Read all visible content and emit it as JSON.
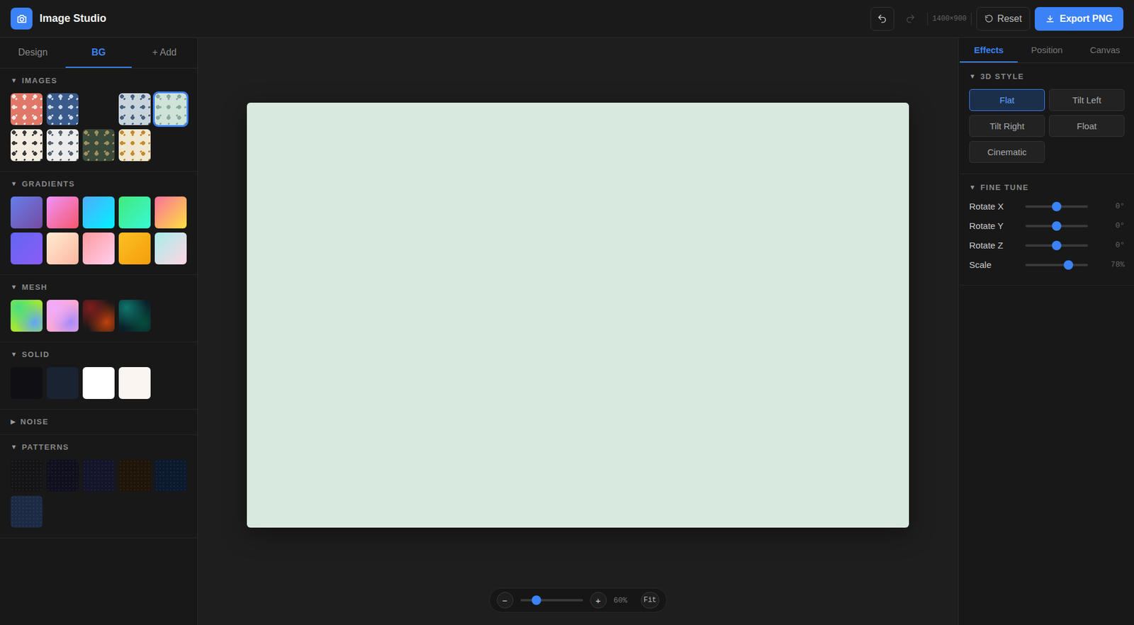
{
  "app": {
    "title": "Image Studio"
  },
  "toolbar": {
    "undo": {
      "disabled": false
    },
    "redo": {
      "disabled": true
    },
    "size": "1400×900",
    "reset": "Reset",
    "export": "Export PNG"
  },
  "left_tabs": [
    {
      "label": "Design",
      "selected": false
    },
    {
      "label": "BG",
      "selected": true
    },
    {
      "label": "+ Add",
      "selected": false
    }
  ],
  "sections": [
    {
      "title": "IMAGES",
      "arrow": "▼",
      "expanded": true,
      "kind": "image",
      "swatches": [
        {
          "colors": [
            "#e0786a",
            "#f2e6e0"
          ],
          "loaded": true,
          "selected": false
        },
        {
          "colors": [
            "#3a5a8c",
            "#c8d8e8"
          ],
          "loaded": true,
          "selected": false
        },
        {
          "colors": [
            "#181818",
            "#181818"
          ],
          "loaded": false,
          "selected": false
        },
        {
          "colors": [
            "#c8d4dc",
            "#4a6080"
          ],
          "loaded": true,
          "selected": false
        },
        {
          "colors": [
            "#cfe3d8",
            "#8aa8a0"
          ],
          "loaded": true,
          "selected": true
        },
        {
          "colors": [
            "#f4ece0",
            "#3a3a3a"
          ],
          "loaded": true,
          "selected": false
        },
        {
          "colors": [
            "#ececec",
            "#5a6470"
          ],
          "loaded": true,
          "selected": false
        },
        {
          "colors": [
            "#3a4a3a",
            "#a09060"
          ],
          "loaded": true,
          "selected": false
        },
        {
          "colors": [
            "#f0e8d0",
            "#c88a30"
          ],
          "loaded": true,
          "selected": false
        }
      ]
    },
    {
      "title": "GRADIENTS",
      "arrow": "▼",
      "expanded": true,
      "kind": "gradient",
      "swatches": [
        {
          "colors": [
            "#667eea",
            "#764ba2"
          ],
          "loaded": true,
          "selected": false
        },
        {
          "colors": [
            "#f093fb",
            "#f5576c"
          ],
          "loaded": true,
          "selected": false
        },
        {
          "colors": [
            "#4facfe",
            "#00f2fe"
          ],
          "loaded": true,
          "selected": false
        },
        {
          "colors": [
            "#43e97b",
            "#38f9d7"
          ],
          "loaded": true,
          "selected": false
        },
        {
          "colors": [
            "#fa709a",
            "#fee140"
          ],
          "loaded": true,
          "selected": false
        },
        {
          "colors": [
            "#6366f1",
            "#8b5cf6"
          ],
          "loaded": true,
          "selected": false
        },
        {
          "colors": [
            "#ffecd2",
            "#fcb69f"
          ],
          "loaded": true,
          "selected": false
        },
        {
          "colors": [
            "#ff9a9e",
            "#fecfef"
          ],
          "loaded": true,
          "selected": false
        },
        {
          "colors": [
            "#fbbf24",
            "#f59e0b"
          ],
          "loaded": true,
          "selected": false
        },
        {
          "colors": [
            "#a8edea",
            "#fed6e3"
          ],
          "loaded": true,
          "selected": false
        }
      ]
    },
    {
      "title": "MESH",
      "arrow": "▼",
      "expanded": true,
      "kind": "mesh",
      "swatches": [
        {
          "colors": [
            "#4ade80",
            "#60a5fa",
            "#a3e635"
          ],
          "loaded": true,
          "selected": false
        },
        {
          "colors": [
            "#f0abfc",
            "#a78bfa",
            "#f9a8d4"
          ],
          "loaded": true,
          "selected": false
        },
        {
          "colors": [
            "#7f1d1d",
            "#c2410c",
            "#1c1917"
          ],
          "loaded": true,
          "selected": false
        },
        {
          "colors": [
            "#0f766e",
            "#064e3b",
            "#0b1f2a"
          ],
          "loaded": true,
          "selected": false
        }
      ]
    },
    {
      "title": "SOLID",
      "arrow": "▼",
      "expanded": true,
      "kind": "solid",
      "swatches": [
        {
          "colors": [
            "#0f0f14"
          ],
          "loaded": true,
          "selected": false
        },
        {
          "colors": [
            "#1a2332"
          ],
          "loaded": true,
          "selected": false
        },
        {
          "colors": [
            "#ffffff"
          ],
          "loaded": true,
          "selected": false
        },
        {
          "colors": [
            "#faf5f0"
          ],
          "loaded": true,
          "selected": false
        }
      ]
    },
    {
      "title": "NOISE",
      "arrow": "▶",
      "expanded": false,
      "kind": "noise",
      "swatches": []
    },
    {
      "title": "PATTERNS",
      "arrow": "▼",
      "expanded": true,
      "kind": "pattern",
      "swatches": [
        {
          "colors": [
            "#141416"
          ],
          "loaded": true,
          "selected": false
        },
        {
          "colors": [
            "#0f0f1e"
          ],
          "loaded": true,
          "selected": false
        },
        {
          "colors": [
            "#14142a"
          ],
          "loaded": true,
          "selected": false
        },
        {
          "colors": [
            "#1f1508"
          ],
          "loaded": true,
          "selected": false
        },
        {
          "colors": [
            "#0c1a2e"
          ],
          "loaded": true,
          "selected": false
        },
        {
          "colors": [
            "#1c2a44"
          ],
          "loaded": true,
          "selected": false
        }
      ]
    }
  ],
  "right_tabs": [
    {
      "label": "Effects",
      "selected": true
    },
    {
      "label": "Position",
      "selected": false
    },
    {
      "label": "Canvas",
      "selected": false
    }
  ],
  "style_section": {
    "title": "3D STYLE",
    "arrow": "▼",
    "presets": [
      {
        "label": "Flat",
        "selected": true
      },
      {
        "label": "Tilt Left",
        "selected": false
      },
      {
        "label": "Tilt Right",
        "selected": false
      },
      {
        "label": "Float",
        "selected": false
      },
      {
        "label": "Cinematic",
        "selected": false
      }
    ]
  },
  "fine_tune": {
    "title": "FINE TUNE",
    "arrow": "▼",
    "rows": [
      {
        "label": "Rotate X",
        "level": 0.5,
        "reading": "0°"
      },
      {
        "label": "Rotate Y",
        "level": 0.5,
        "reading": "0°"
      },
      {
        "label": "Rotate Z",
        "level": 0.5,
        "reading": "0°"
      },
      {
        "label": "Scale",
        "level": 0.69,
        "reading": "78%"
      }
    ]
  },
  "zoom": {
    "minus": "−",
    "plus": "+",
    "level": 0.26,
    "reading": "60%",
    "fit": "Fit"
  }
}
